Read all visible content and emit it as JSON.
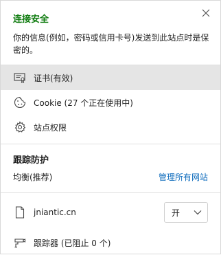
{
  "header": {
    "title": "连接安全",
    "description": "你的信息(例如，密码或信用卡号)发送到此站点时是保密的。",
    "close_icon": "close-icon"
  },
  "menu": {
    "items": [
      {
        "label": "证书(有效)",
        "icon": "certificate-icon",
        "active": true
      },
      {
        "label": "Cookie (27 个正在使用中)",
        "icon": "cookie-icon",
        "active": false
      },
      {
        "label": "站点权限",
        "icon": "gear-icon",
        "active": false
      }
    ]
  },
  "tracking": {
    "title": "跟踪防护",
    "mode": "均衡(推荐)",
    "manage_link": "管理所有网站"
  },
  "site": {
    "domain": "jniantic.cn",
    "toggle_value": "开"
  },
  "trackers": {
    "label": "跟踪器 (已阻止 0 个)"
  },
  "colors": {
    "title_green": "#107c10",
    "link_blue": "#0f6cbd",
    "active_bg": "#e5e5e5"
  }
}
